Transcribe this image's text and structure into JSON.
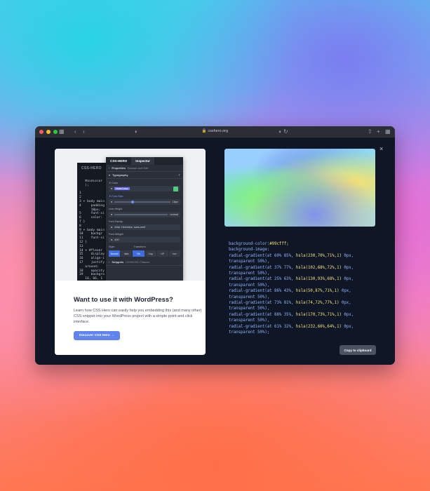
{
  "browser": {
    "url": "csshero.org",
    "dot_colors": [
      "#ff5f57",
      "#febc2e",
      "#28c840"
    ]
  },
  "card": {
    "title": "Want to use it with WordPress?",
    "text": "Learn how CSS Hero can easily help you embedding this (and many other) CSS snippet into your WordPress project with a simple point and click interface.",
    "button": "Discover CSS Hero →"
  },
  "screenshot": {
    "editor_logo": "CSS-HERO",
    "code_lines": "   MainColor\n   );\n\n1\n2\n3 ▾ body main\n4     padding\n      10px;\n5     font-si\n6     color:\n7 }\n8\n9 ▾ body main\n10    backgr\n11    font-si\n12 }\n13\n14 ▾ #flexer\n15    display\n16    align-i\n17    justify\n   around;\n18    opacity\n19    backgro\n   16, 66, 1",
    "panel_logo": "CSS-HERO",
    "panel_tab": "Inspector",
    "properties": "Properties",
    "browse": "Browse and Edit",
    "typography": "Typography",
    "color_label": "Color",
    "color_value": "MainColor",
    "font_size_label": "Font-Size",
    "font_size_value": "18px",
    "line_height_label": "Line-Height",
    "line_height_value": "normal",
    "font_family_label": "Font-Family",
    "font_family_value": "Arial, Helvetica, sans-serif",
    "font_weight_label": "Font-Weight",
    "font_weight_value": "400",
    "style_label": "Style",
    "transform_label": "Transform",
    "style_opts": [
      "Normal",
      "Italic"
    ],
    "transform_opts": [
      "Nn",
      "Cap",
      "UP",
      "low"
    ],
    "snippets": "Snippets",
    "snippets_sub": "LESSCSS Classes"
  },
  "code": [
    [
      {
        "t": "background-color:",
        "c": "k"
      },
      {
        "t": "#99cfff;",
        "c": "v"
      }
    ],
    [
      {
        "t": "background-image:",
        "c": "k"
      }
    ],
    [
      {
        "t": "radial-gradient(at 60% 85%, ",
        "c": "k"
      },
      {
        "t": "hsla(230,70%,71%,1)",
        "c": "v"
      },
      {
        "t": " 0px,",
        "c": "k"
      }
    ],
    [
      {
        "t": "transparent 50%),",
        "c": "k"
      }
    ],
    [
      {
        "t": "radial-gradient(at 37% 77%, ",
        "c": "k"
      },
      {
        "t": "hsla(102,68%,72%,1)",
        "c": "v"
      },
      {
        "t": " 0px,",
        "c": "k"
      }
    ],
    [
      {
        "t": "transparent 50%),",
        "c": "k"
      }
    ],
    [
      {
        "t": "radial-gradient(at 25% 63%, ",
        "c": "k"
      },
      {
        "t": "hsla(130,93%,68%,1)",
        "c": "v"
      },
      {
        "t": " 0px,",
        "c": "k"
      }
    ],
    [
      {
        "t": "transparent 50%),",
        "c": "k"
      }
    ],
    [
      {
        "t": "radial-gradient(at 86% 43%, ",
        "c": "k"
      },
      {
        "t": "hsla(50,87%,71%,1)",
        "c": "v"
      },
      {
        "t": " 0px,",
        "c": "k"
      }
    ],
    [
      {
        "t": "transparent 50%),",
        "c": "k"
      }
    ],
    [
      {
        "t": "radial-gradient(at 73% 81%, ",
        "c": "k"
      },
      {
        "t": "hsla(74,72%,77%,1)",
        "c": "v"
      },
      {
        "t": " 0px,",
        "c": "k"
      }
    ],
    [
      {
        "t": "transparent 50%),",
        "c": "k"
      }
    ],
    [
      {
        "t": "radial-gradient(at 88% 35%, ",
        "c": "k"
      },
      {
        "t": "hsla(170,73%,71%,1)",
        "c": "v"
      },
      {
        "t": " 0px,",
        "c": "k"
      }
    ],
    [
      {
        "t": "transparent 50%),",
        "c": "k"
      }
    ],
    [
      {
        "t": "radial-gradient(at 61% 32%, ",
        "c": "k"
      },
      {
        "t": "hsla(232,66%,64%,1)",
        "c": "v"
      },
      {
        "t": " 0px,",
        "c": "k"
      }
    ],
    [
      {
        "t": "transparent 50%);",
        "c": "k"
      }
    ]
  ],
  "copy_button": "Copy to clipboard",
  "close_icon": "×"
}
